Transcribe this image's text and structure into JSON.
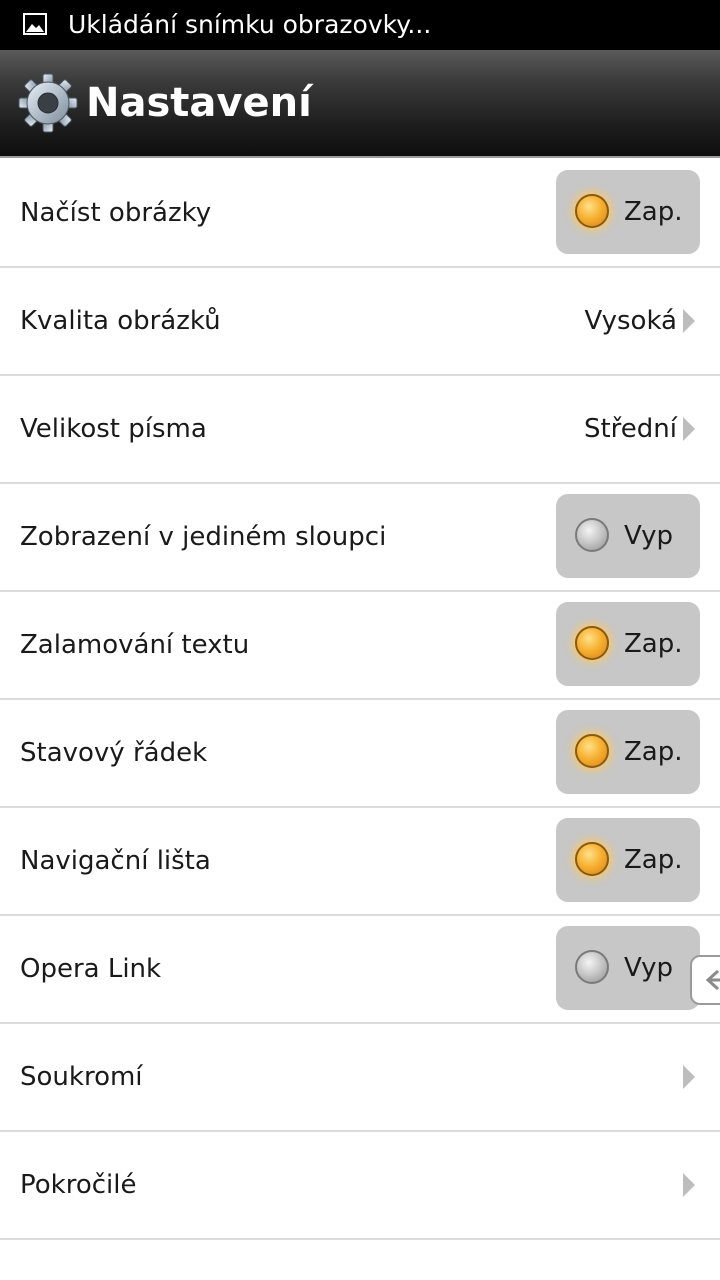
{
  "status_bar": {
    "icon": "image-icon",
    "text": "Ukládání snímku obrazovky..."
  },
  "header": {
    "icon": "gear-icon",
    "title": "Nastavení"
  },
  "settings": [
    {
      "label": "Načíst obrázky",
      "type": "toggle",
      "state": "on",
      "value": "Zap."
    },
    {
      "label": "Kvalita obrázků",
      "type": "link",
      "value": "Vysoká"
    },
    {
      "label": "Velikost písma",
      "type": "link",
      "value": "Střední"
    },
    {
      "label": "Zobrazení v jediném sloupci",
      "type": "toggle",
      "state": "off",
      "value": "Vyp"
    },
    {
      "label": "Zalamování textu",
      "type": "toggle",
      "state": "on",
      "value": "Zap."
    },
    {
      "label": "Stavový řádek",
      "type": "toggle",
      "state": "on",
      "value": "Zap."
    },
    {
      "label": "Navigační lišta",
      "type": "toggle",
      "state": "on",
      "value": "Zap."
    },
    {
      "label": "Opera Link",
      "type": "toggle",
      "state": "off",
      "value": "Vyp"
    },
    {
      "label": "Soukromí",
      "type": "link",
      "value": ""
    },
    {
      "label": "Pokročilé",
      "type": "link",
      "value": ""
    }
  ],
  "colors": {
    "toggle_bg": "#c7c7c7",
    "led_on": "#f7b233",
    "led_off": "#b8b8b8"
  }
}
